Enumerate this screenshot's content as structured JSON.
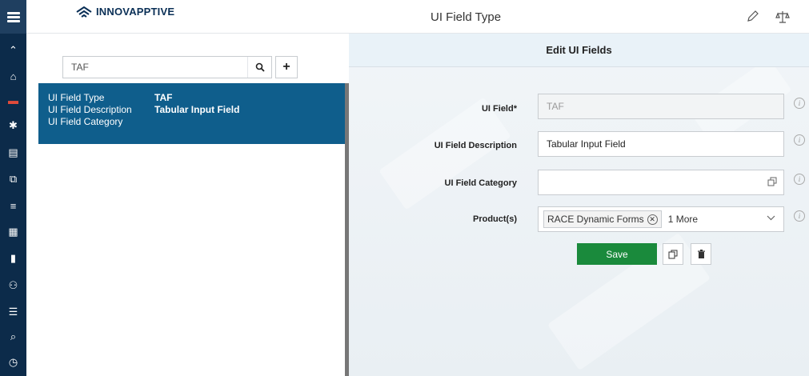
{
  "header": {
    "logo_text": "INNOVAPPTIVE",
    "title": "UI Field Type",
    "edit_icon": "pencil-icon",
    "compare_icon": "scale-icon"
  },
  "rail": {
    "items": [
      {
        "icon": "home-icon",
        "glyph": "🏠"
      },
      {
        "icon": "server-icon",
        "glyph": "▭",
        "active": true
      },
      {
        "icon": "puzzle-icon",
        "glyph": "✱"
      },
      {
        "icon": "document-add-icon",
        "glyph": "▤"
      },
      {
        "icon": "copy-icon",
        "glyph": "⧉"
      },
      {
        "icon": "filter-icon",
        "glyph": "≡"
      },
      {
        "icon": "table-icon",
        "glyph": "▦"
      },
      {
        "icon": "file-icon",
        "glyph": "▮"
      },
      {
        "icon": "network-icon",
        "glyph": "⚇"
      },
      {
        "icon": "list-icon",
        "glyph": "☰"
      },
      {
        "icon": "paperclip-icon",
        "glyph": "✎"
      },
      {
        "icon": "clock-icon",
        "glyph": "◷"
      }
    ]
  },
  "search": {
    "value": "TAF",
    "placeholder": ""
  },
  "result": {
    "rows": [
      {
        "key": "UI Field Type",
        "value": "TAF"
      },
      {
        "key": "UI Field Description",
        "value": "Tabular Input Field"
      },
      {
        "key": "UI Field Category",
        "value": ""
      }
    ]
  },
  "edit": {
    "title": "Edit UI Fields",
    "field_label": "UI Field*",
    "field_value": "TAF",
    "desc_label": "UI Field Description",
    "desc_value": "Tabular Input Field",
    "category_label": "UI Field Category",
    "category_value": "",
    "products_label": "Product(s)",
    "product_chip": "RACE Dynamic Forms",
    "products_more": "1 More",
    "save_label": "Save",
    "info_glyph": "i"
  }
}
